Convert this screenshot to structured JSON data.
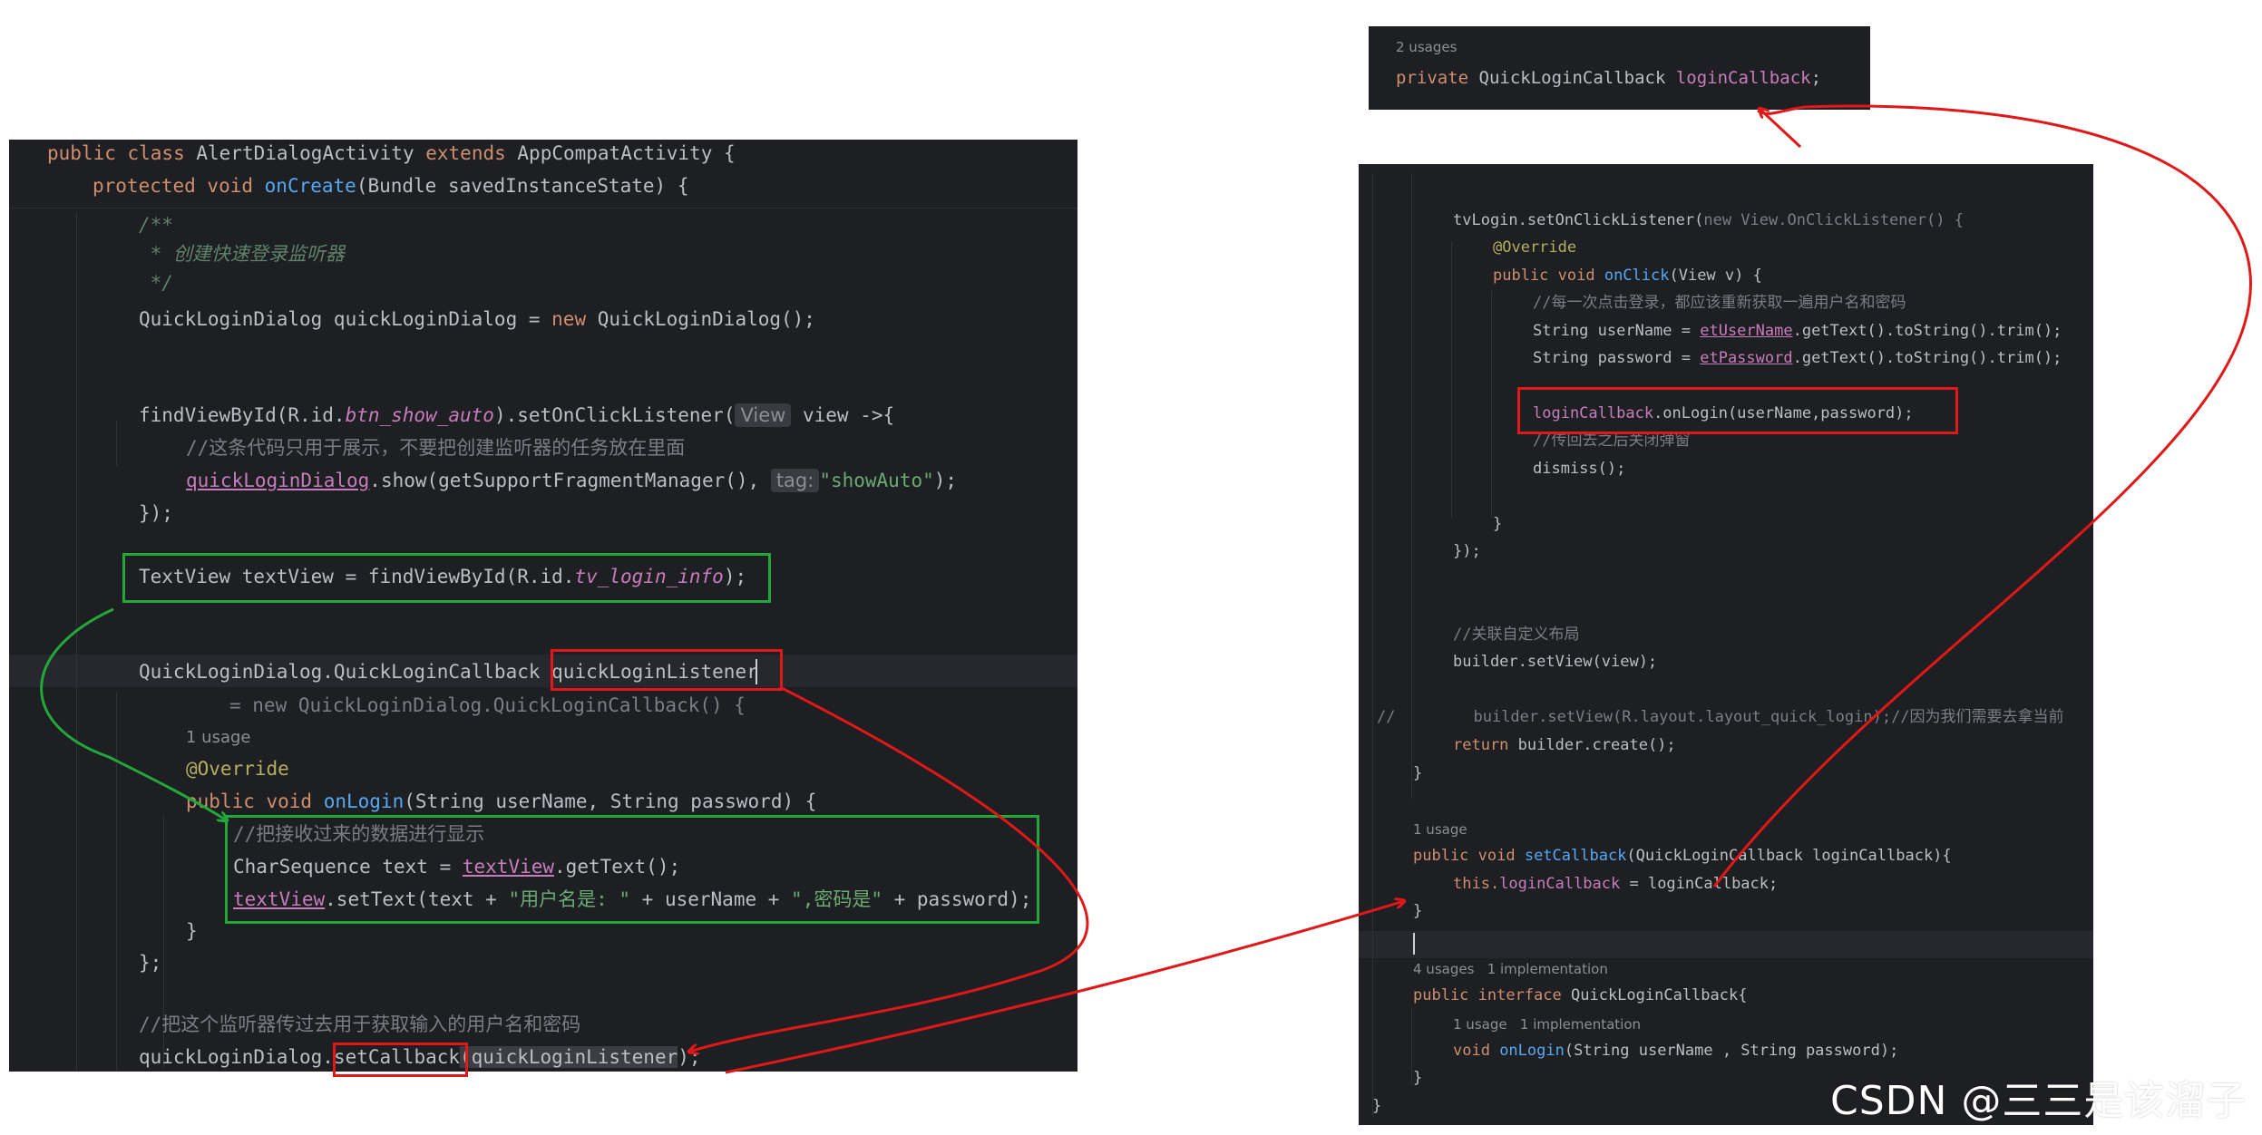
{
  "left": {
    "l1": {
      "kw1": "public class ",
      "cls": "AlertDialogActivity ",
      "kw2": "extends ",
      "sup": "AppCompatActivity {"
    },
    "l2": {
      "kw": "protected void ",
      "fn": "onCreate",
      "rest": "(Bundle savedInstanceState) {"
    },
    "doc1": "/**",
    "doc2": " * 创建快速登录监听器",
    "doc3": " */",
    "l6": {
      "a": "QuickLoginDialog quickLoginDialog = ",
      "kw": "new ",
      "b": "QuickLoginDialog();"
    },
    "l8": {
      "a": "findViewById(R.id.",
      "id": "btn_show_auto",
      "b": ").setOnClickListener(",
      "tip": "View",
      "c": " view ->{"
    },
    "l9": "//这条代码只用于展示，不要把创建监听器的任务放在里面",
    "l10": {
      "fld": "quickLoginDialog",
      "a": ".show(getSupportFragmentManager(), ",
      "tip": "tag:",
      "str": "\"showAuto\"",
      "b": ");"
    },
    "l11": "});",
    "l13": {
      "a": "TextView textView = findViewById(R.id.",
      "id": "tv_login_info",
      "b": ");"
    },
    "l15": {
      "a": "QuickLoginDialog.QuickLoginCallback ",
      "b": "quickLoginListener"
    },
    "l16": {
      "a": "= new QuickLoginDialog.QuickLoginCallback() {"
    },
    "usage": "1 usage",
    "ann": "@Override",
    "l19": {
      "kw": "public void ",
      "fn": "onLogin",
      "rest": "(String userName, String password) {"
    },
    "l20": "//把接收过来的数据进行显示",
    "l21": {
      "a": "CharSequence text = ",
      "fld": "textView",
      "b": ".getText();"
    },
    "l22": {
      "fld": "textView",
      "a": ".setText(text + ",
      "s1": "\"用户名是: \"",
      "b": " + userName + ",
      "s2": "\",密码是\"",
      "c": " + password);"
    },
    "l23": "}",
    "l24": "};",
    "l26": "//把这个监听器传过去用于获取输入的用户名和密码",
    "l27": {
      "a": "quickLoginDialog.",
      "m": "setCallback",
      "p": "(quickLoginListener",
      "b": ");"
    }
  },
  "top": {
    "usages": "2 usages",
    "kw": "private ",
    "type": "QuickLoginCallback ",
    "fld": "loginCallback",
    "end": ";"
  },
  "right": {
    "r1": {
      "a": "tvLogin.setOnClickListener(",
      "kw": "new ",
      "b": "View.OnClickListener() {"
    },
    "r2": "@Override",
    "r3": {
      "kw": "public void ",
      "fn": "onClick",
      "rest": "(View v) {"
    },
    "r4": "//每一次点击登录，都应该重新获取一遍用户名和密码",
    "r5": {
      "a": "String userName = ",
      "fld": "etUserName",
      "b": ".getText().toString().trim();"
    },
    "r6": {
      "a": "String password = ",
      "fld": "etPassword",
      "b": ".getText().toString().trim();"
    },
    "r7": {
      "fld": "loginCallback",
      "b": ".onLogin(userName,password);"
    },
    "r8": "//传回去之后关闭弹窗",
    "r9": "dismiss();",
    "r10": "}",
    "r11": "});",
    "r12": "//关联自定义布局",
    "r13": "builder.setView(view);",
    "r14": {
      "slash": "//",
      "a": "builder.setView(R.layout.layout_quick_login);",
      "c": "//因为我们需要去拿当前"
    },
    "r15": {
      "kw": "return ",
      "a": "builder.create();"
    },
    "r16": "}",
    "r17": "1 usage",
    "r18": {
      "kw": "public void ",
      "fn": "setCallback",
      "rest": "(QuickLoginCallback loginCallback){"
    },
    "r19": {
      "kw": "this.",
      "fld": "loginCallback",
      "b": " = loginCallback;"
    },
    "r20": "}",
    "r21": "4 usages   1 implementation",
    "r22": {
      "kw": "public interface ",
      "a": "QuickLoginCallback{"
    },
    "r23": "1 usage   1 implementation",
    "r24": {
      "kw": "void ",
      "fn": "onLogin",
      "rest": "(String userName , String password);"
    },
    "r25": "}",
    "r26": "}"
  },
  "watermark": "CSDN @三三是该溜子",
  "colors": {
    "red": "#e01818",
    "green": "#22a83a",
    "bg": "#1e1f22"
  }
}
